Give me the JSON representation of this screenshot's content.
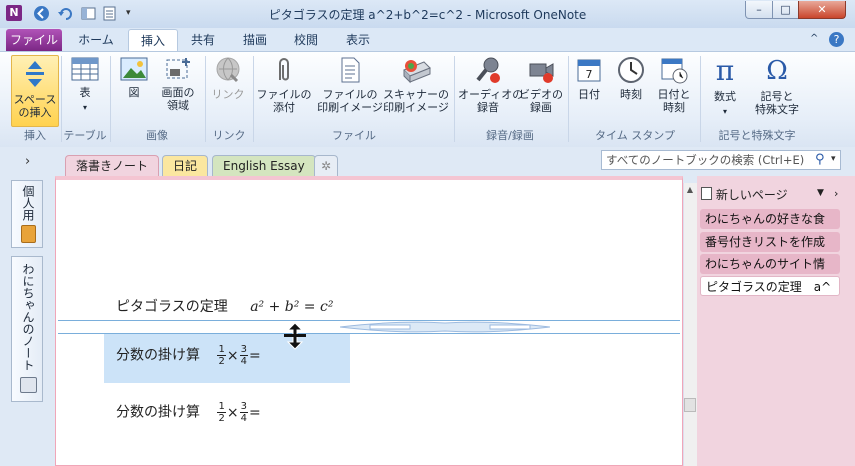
{
  "window": {
    "title": "ピタゴラスの定理  a^2+b^2=c^2  -  Microsoft OneNote",
    "min": "–",
    "max": "□",
    "close": "✕"
  },
  "ribbon_tabs": [
    "ファイル",
    "ホーム",
    "挿入",
    "共有",
    "描画",
    "校閲",
    "表示"
  ],
  "ribbon": {
    "buttons": {
      "space": "スペース\nの挿入",
      "table": "表",
      "picture": "図",
      "screen_clip": "画面の\n領域",
      "link": "リンク",
      "attach_file": "ファイルの\n添付",
      "file_printout": "ファイルの\n印刷イメージ",
      "scanner_printout": "スキャナーの\n印刷イメージ",
      "audio": "オーディオの\n録音",
      "video": "ビデオの\n録画",
      "date": "日付",
      "time": "時刻",
      "date_time": "日付と\n時刻",
      "equation": "数式",
      "symbol": "記号と\n特殊文字"
    },
    "groups": [
      "挿入",
      "テーブル",
      "画像",
      "リンク",
      "ファイル",
      "録音/録画",
      "タイム スタンプ",
      "記号と特殊文字"
    ]
  },
  "notebook_tabs": [
    "落書きノート",
    "日記",
    "English Essay"
  ],
  "search_placeholder": "すべてのノートブックの検索 (Ctrl+E)",
  "left_pane": {
    "notebook1": "個人用",
    "notebook2": "わにちゃんのノート",
    "expand": "›"
  },
  "page_content": {
    "line1_text": "ピタゴラスの定理",
    "line1_eq": "a² + b² = c²",
    "line2_text": "分数の掛け算",
    "line3_text": "分数の掛け算",
    "frac1_num": "1",
    "frac1_den": "2",
    "frac2_num": "3",
    "frac2_den": "4",
    "times": "×",
    "equals": "="
  },
  "page_list": {
    "new_page": "新しいページ",
    "pages": [
      "わにちゃんの好きな食",
      "番号付きリストを作成",
      "わにちゃんのサイト情",
      "ピタゴラスの定理　a^"
    ]
  },
  "colors": {
    "accent": "#7b2785",
    "page_tab": "#f1d4df",
    "selection": "#cce3f8"
  }
}
